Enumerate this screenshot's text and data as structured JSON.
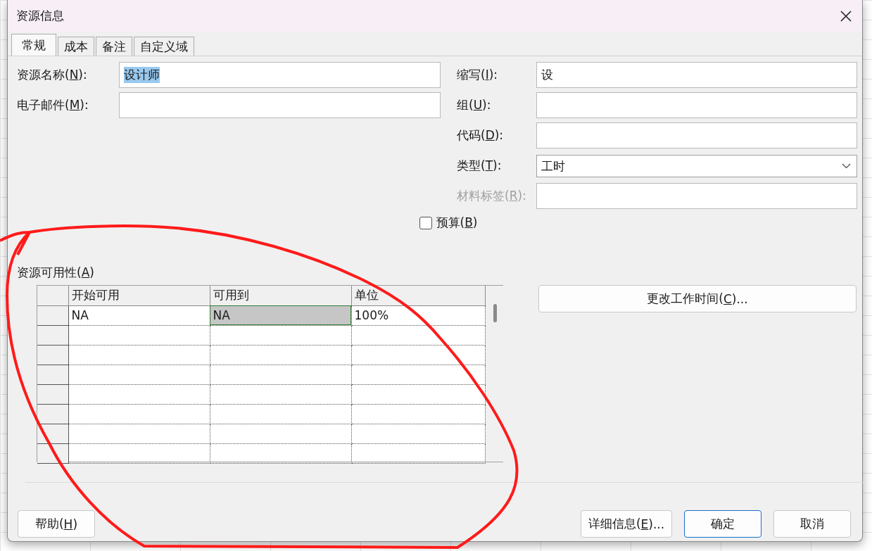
{
  "window": {
    "title": "资源信息"
  },
  "tabs": [
    {
      "label": "常规",
      "selected": true
    },
    {
      "label": "成本",
      "selected": false
    },
    {
      "label": "备注",
      "selected": false
    },
    {
      "label": "自定义域",
      "selected": false
    }
  ],
  "fields_left": [
    {
      "label": [
        "资源名称(",
        "N",
        "):"
      ],
      "value": "设计师",
      "value_selected": true,
      "kind": "text"
    },
    {
      "label": [
        "电子邮件(",
        "M",
        "):"
      ],
      "kind": "text"
    }
  ],
  "fields_right": [
    {
      "label": [
        "缩写(",
        "I",
        "):"
      ],
      "value": "设",
      "kind": "text"
    },
    {
      "label": [
        "组(",
        "U",
        "):"
      ],
      "kind": "text"
    },
    {
      "label": [
        "代码(",
        "D",
        "):"
      ],
      "kind": "text"
    },
    {
      "label": [
        "类型(",
        "T",
        "):"
      ],
      "value": "工时",
      "kind": "dropdown"
    },
    {
      "label": [
        "材料标签(",
        "R",
        "):"
      ],
      "kind": "text",
      "disabled": true
    }
  ],
  "budget_checkbox": {
    "label": [
      "预算(",
      "B",
      ")"
    ],
    "checked": false
  },
  "availability": {
    "label": [
      "资源可用性(",
      "A",
      ")"
    ],
    "columns": [
      "开始可用",
      "可用到",
      "单位"
    ],
    "rows": [
      {
        "cells": [
          {
            "text": "NA",
            "selected": false
          },
          {
            "text": "NA",
            "selected": true
          },
          {
            "text": "100%",
            "selected": false
          }
        ]
      }
    ]
  },
  "change_time_button": {
    "label": [
      "更改工作时间(",
      "C",
      ")..."
    ]
  },
  "buttons": [
    {
      "label": [
        "帮助(",
        "H",
        ")"
      ],
      "default": false
    },
    {
      "label": [
        "详细信息(",
        "E",
        ")..."
      ],
      "default": false
    },
    {
      "label": [
        "确定"
      ],
      "default": true
    },
    {
      "label": [
        "取消"
      ],
      "default": false
    }
  ]
}
